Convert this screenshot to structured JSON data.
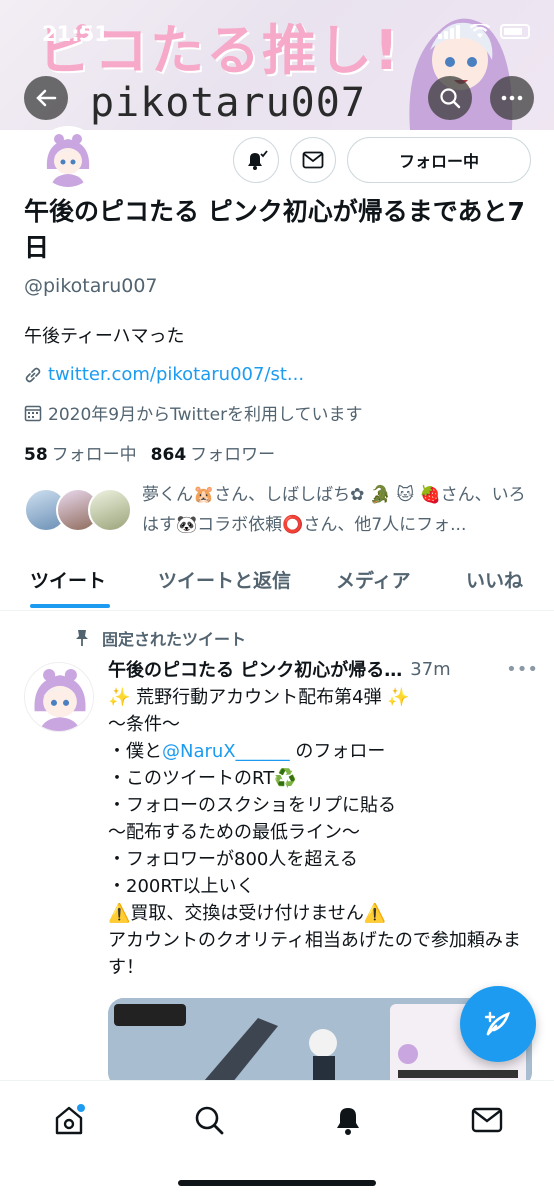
{
  "status_bar": {
    "time": "21:51"
  },
  "banner": {
    "art_title": "ピコたる推し!",
    "art_handle": "pikotaru007"
  },
  "profile": {
    "display_name": "午後のピコたる ピンク初心が帰るまであと7日",
    "handle": "@pikotaru007",
    "bio": "午後ティーハマった",
    "link": "twitter.com/pikotaru007/st...",
    "joined": "2020年9月からTwitterを利用しています",
    "following_count": "58",
    "following_label": "フォロー中",
    "followers_count": "864",
    "followers_label": "フォロワー",
    "known_followers_text": "夢くん🐹さん、しばしばち✿ 🐊 🐱 🍓さん、いろはす🐼コラボ依頼⭕さん、他7人にフォ...",
    "follow_button": "フォロー中"
  },
  "tabs": [
    {
      "label": "ツイート"
    },
    {
      "label": "ツイートと返信"
    },
    {
      "label": "メディア"
    },
    {
      "label": "いいね"
    }
  ],
  "tweet": {
    "pinned_label": "固定されたツイート",
    "author": "午後のピコたる ピンク初心が帰る…",
    "time": "37m",
    "lines": [
      "✨ 荒野行動アカウント配布第4弾 ✨",
      "〜条件〜",
      "・僕と",
      "@NaruX______",
      " のフォロー",
      "・このツイートのRT♻️",
      "・フォローのスクショをリプに貼る",
      "〜配布するための最低ライン〜",
      "・フォロワーが800人を超える",
      "・200RT以上いく",
      "⚠️買取、交換は受け付けません⚠️",
      "アカウントのクオリティ相当あげたので参加頼みます！"
    ]
  },
  "colors": {
    "accent": "#1d9bf0",
    "text": "#0f1419",
    "muted": "#536471"
  }
}
